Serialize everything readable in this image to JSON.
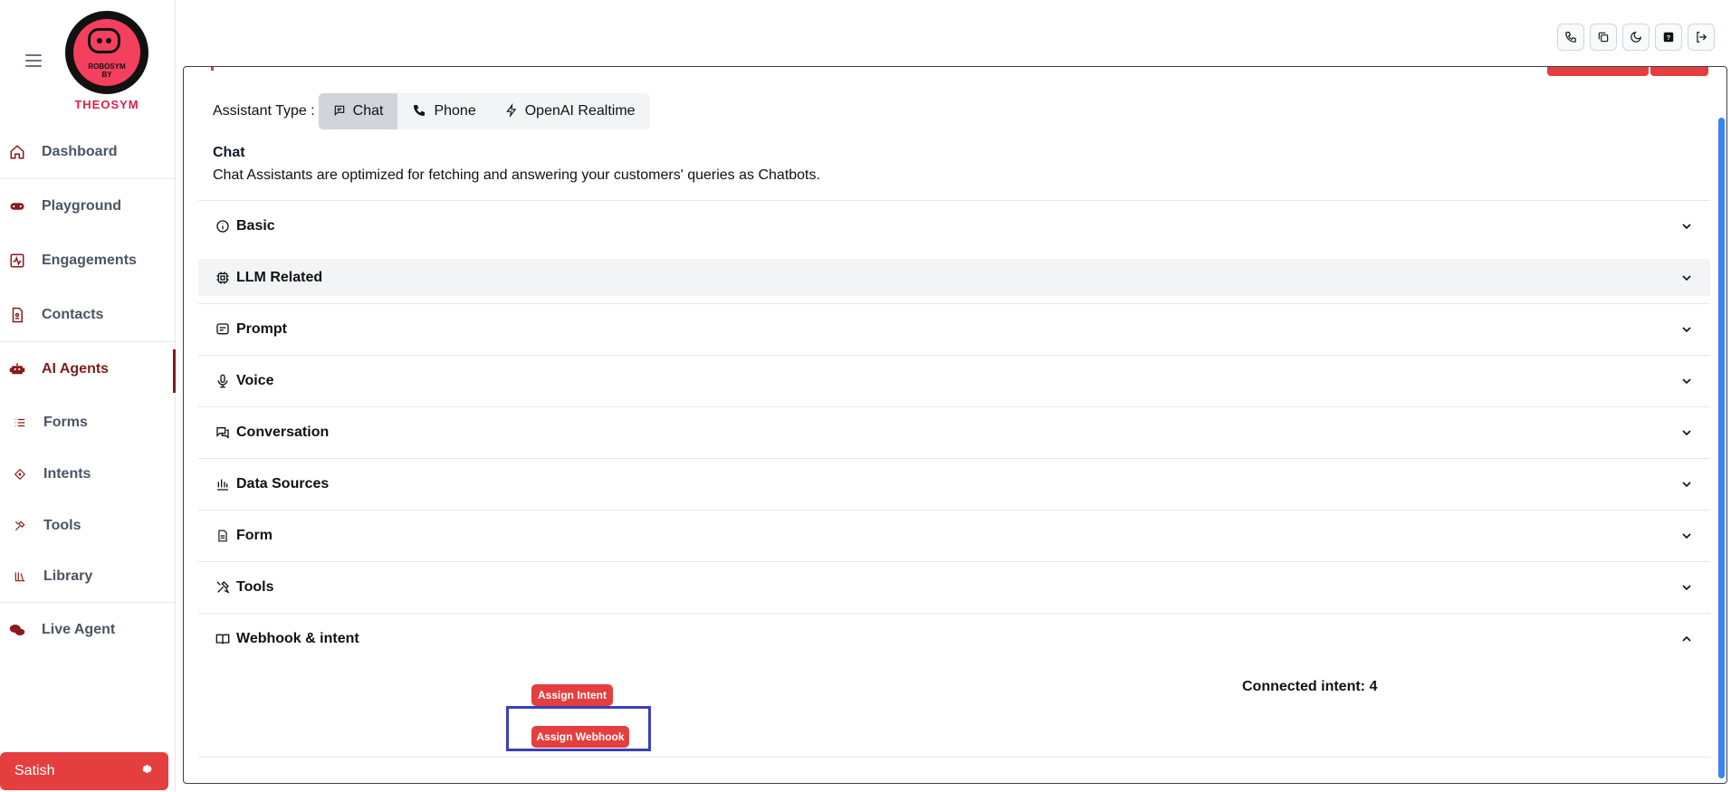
{
  "sidebar": {
    "logo": {
      "line1": "ROBOSYM",
      "line2": "BY",
      "brand": "THEOSYM"
    },
    "items": [
      {
        "label": "Dashboard",
        "icon": "home-icon"
      },
      {
        "label": "Playground",
        "icon": "gamepad-icon"
      },
      {
        "label": "Engagements",
        "icon": "activity-icon"
      },
      {
        "label": "Contacts",
        "icon": "contact-card-icon"
      },
      {
        "label": "AI Agents",
        "icon": "robot-icon",
        "active": true
      }
    ],
    "subitems": [
      {
        "label": "Forms",
        "icon": "list-icon"
      },
      {
        "label": "Intents",
        "icon": "diamond-icon"
      },
      {
        "label": "Tools",
        "icon": "tools-icon"
      },
      {
        "label": "Library",
        "icon": "library-icon"
      }
    ],
    "live_agent": {
      "label": "Live Agent",
      "icon": "chat-bubbles-icon"
    },
    "user": {
      "name": "Satish",
      "icon": "gear-icon"
    }
  },
  "toolbar": {
    "buttons": [
      "phone-icon",
      "copy-icon",
      "moon-icon",
      "help-icon",
      "logout-icon"
    ]
  },
  "assistant": {
    "type_label": "Assistant Type :",
    "types": [
      {
        "label": "Chat",
        "icon": "chat-icon",
        "active": true
      },
      {
        "label": "Phone",
        "icon": "phone-icon"
      },
      {
        "label": "OpenAI Realtime",
        "icon": "bolt-icon"
      }
    ],
    "desc_title": "Chat",
    "desc_text": "Chat Assistants are optimized for fetching and answering your customers' queries as Chatbots."
  },
  "sections": [
    {
      "label": "Basic",
      "icon": "info-icon"
    },
    {
      "label": "LLM Related",
      "icon": "chip-icon"
    },
    {
      "label": "Prompt",
      "icon": "message-square-icon"
    },
    {
      "label": "Voice",
      "icon": "microphone-icon"
    },
    {
      "label": "Conversation",
      "icon": "conversation-icon"
    },
    {
      "label": "Data Sources",
      "icon": "bank-icon"
    },
    {
      "label": "Form",
      "icon": "file-icon"
    },
    {
      "label": "Tools",
      "icon": "tools-icon"
    },
    {
      "label": "Webhook & intent",
      "icon": "book-icon"
    }
  ],
  "webhook": {
    "assign_intent": "Assign Intent",
    "assign_webhook": "Assign Webhook",
    "connected": "Connected intent: 4"
  },
  "colors": {
    "accent": "#e53e3e",
    "sidebar_active": "#7f1d1d",
    "scrollbar": "#3b82f6",
    "focus": "#3b3fb8"
  }
}
